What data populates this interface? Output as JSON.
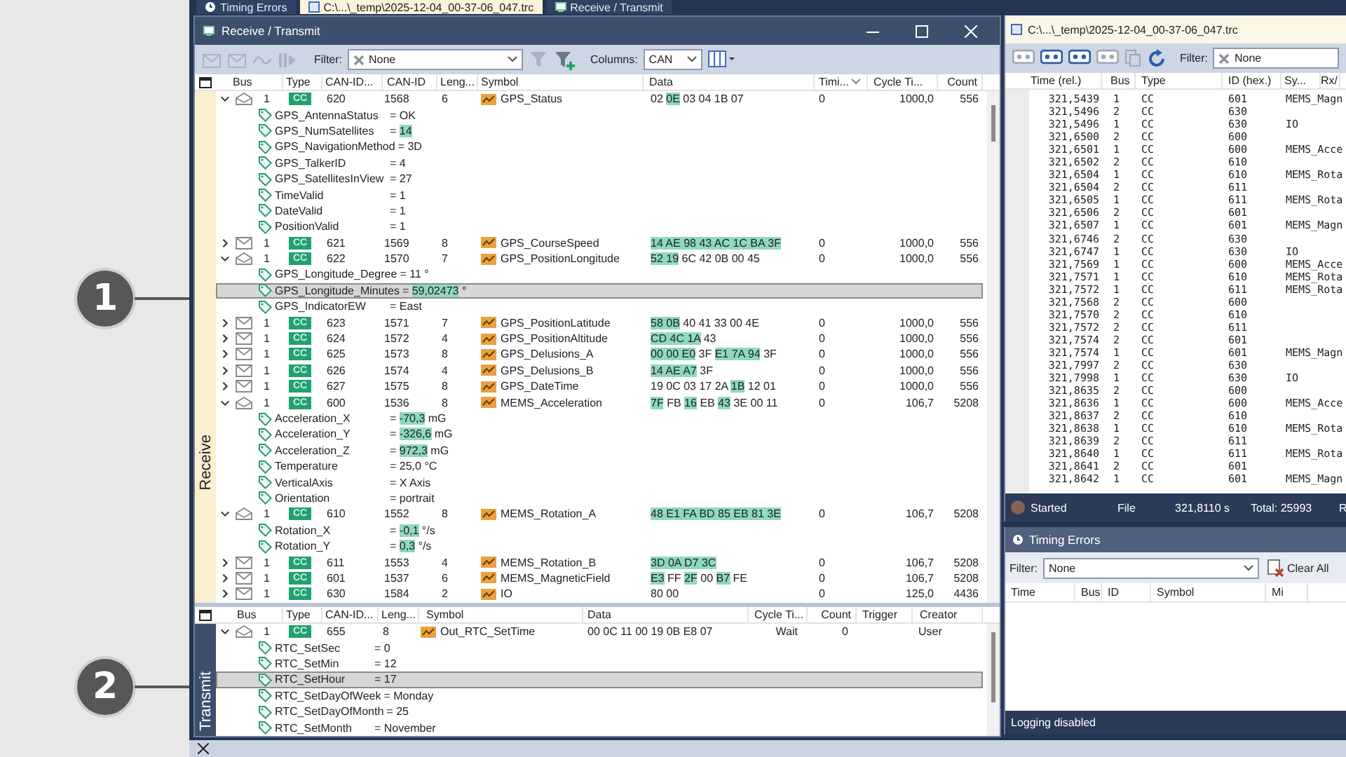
{
  "doc_tabs": [
    {
      "label": "Timing Errors",
      "kind": "clock",
      "selected": false
    },
    {
      "label": "C:\\...\\_temp\\2025-12-04_00-37-06_047.trc",
      "kind": "file",
      "selected": true
    },
    {
      "label": "Receive / Transmit",
      "kind": "window",
      "selected": false
    }
  ],
  "callouts": [
    {
      "number": "1"
    },
    {
      "number": "2"
    }
  ],
  "rx_window": {
    "title": "Receive / Transmit",
    "filter_label": "Filter:",
    "filter_value": "None",
    "columns_label": "Columns:",
    "columns_value": "CAN"
  },
  "receive": {
    "label": "Receive",
    "columns": [
      {
        "label": "Bus",
        "sorted": false
      },
      {
        "label": "Type",
        "sorted": false
      },
      {
        "label": "CAN-ID...",
        "sorted": false
      },
      {
        "label": "CAN-ID",
        "sorted": false
      },
      {
        "label": "Leng...",
        "sorted": false
      },
      {
        "label": "Symbol",
        "sorted": false
      },
      {
        "label": "Data",
        "sorted": false
      },
      {
        "label": "Timi...",
        "sorted": true
      },
      {
        "label": "Cycle Ti...",
        "sorted": false
      },
      {
        "label": "Count",
        "sorted": false
      }
    ],
    "rows": [
      {
        "kind": "message",
        "expanded": true,
        "selected": false,
        "bus": "1",
        "type": "CC",
        "id_hex": "620",
        "id": "1568",
        "length": "6",
        "symbol": "GPS_Status",
        "data": [
          {
            "text": "02",
            "hl": false
          },
          {
            "text": "0E",
            "hl": true
          },
          {
            "text": "03 04 1B 07",
            "hl": false
          }
        ],
        "timing": "0",
        "cycle": "1000,0",
        "count": "556"
      },
      {
        "kind": "signal",
        "selected": false,
        "name": "GPS_AntennaStatus",
        "op": "=",
        "value": "OK",
        "hl": false
      },
      {
        "kind": "signal",
        "selected": false,
        "name": "GPS_NumSatellites",
        "op": "=",
        "value": "14",
        "hl": true
      },
      {
        "kind": "signal",
        "selected": false,
        "name": "GPS_NavigationMethod",
        "op": "=",
        "value": "3D",
        "hl": false
      },
      {
        "kind": "signal",
        "selected": false,
        "name": "GPS_TalkerID",
        "op": "=",
        "value": "4",
        "hl": false
      },
      {
        "kind": "signal",
        "selected": false,
        "name": "GPS_SatellitesInView",
        "op": "=",
        "value": "27",
        "hl": false
      },
      {
        "kind": "signal",
        "selected": false,
        "name": "TimeValid",
        "op": "=",
        "value": "1",
        "hl": false
      },
      {
        "kind": "signal",
        "selected": false,
        "name": "DateValid",
        "op": "=",
        "value": "1",
        "hl": false
      },
      {
        "kind": "signal",
        "selected": false,
        "name": "PositionValid",
        "op": "=",
        "value": "1",
        "hl": false
      },
      {
        "kind": "message",
        "expanded": false,
        "selected": false,
        "bus": "1",
        "type": "CC",
        "id_hex": "621",
        "id": "1569",
        "length": "8",
        "symbol": "GPS_CourseSpeed",
        "data": [
          {
            "text": "14 AE 98 43 AC 1C BA 3F",
            "hl": true
          }
        ],
        "timing": "0",
        "cycle": "1000,0",
        "count": "556"
      },
      {
        "kind": "message",
        "expanded": true,
        "selected": false,
        "bus": "1",
        "type": "CC",
        "id_hex": "622",
        "id": "1570",
        "length": "7",
        "symbol": "GPS_PositionLongitude",
        "data": [
          {
            "text": "52 19",
            "hl": true
          },
          {
            "text": "6C 42 0B 00 45",
            "hl": false
          }
        ],
        "timing": "0",
        "cycle": "1000,0",
        "count": "556"
      },
      {
        "kind": "signal",
        "selected": false,
        "name": "GPS_Longitude_Degree",
        "op": "=",
        "value": "11",
        "unit": "°",
        "hl": false
      },
      {
        "kind": "signal",
        "selected": true,
        "name": "GPS_Longitude_Minutes",
        "op": "=",
        "value": "59,02473",
        "unit": "°",
        "hl": true
      },
      {
        "kind": "signal",
        "selected": false,
        "name": "GPS_IndicatorEW",
        "op": "=",
        "value": "East",
        "hl": false
      },
      {
        "kind": "message",
        "expanded": false,
        "selected": false,
        "bus": "1",
        "type": "CC",
        "id_hex": "623",
        "id": "1571",
        "length": "7",
        "symbol": "GPS_PositionLatitude",
        "data": [
          {
            "text": "58 0B",
            "hl": true
          },
          {
            "text": "40 41 33 00 4E",
            "hl": false
          }
        ],
        "timing": "0",
        "cycle": "1000,0",
        "count": "556"
      },
      {
        "kind": "message",
        "expanded": false,
        "selected": false,
        "bus": "1",
        "type": "CC",
        "id_hex": "624",
        "id": "1572",
        "length": "4",
        "symbol": "GPS_PositionAltitude",
        "data": [
          {
            "text": "CD 4C 1A",
            "hl": true
          },
          {
            "text": "43",
            "hl": false
          }
        ],
        "timing": "0",
        "cycle": "1000,0",
        "count": "556"
      },
      {
        "kind": "message",
        "expanded": false,
        "selected": false,
        "bus": "1",
        "type": "CC",
        "id_hex": "625",
        "id": "1573",
        "length": "8",
        "symbol": "GPS_Delusions_A",
        "data": [
          {
            "text": "00 00 E0",
            "hl": true
          },
          {
            "text": "3F",
            "hl": false
          },
          {
            "text": "E1 7A 94",
            "hl": true
          },
          {
            "text": "3F",
            "hl": false
          }
        ],
        "timing": "0",
        "cycle": "1000,0",
        "count": "556"
      },
      {
        "kind": "message",
        "expanded": false,
        "selected": false,
        "bus": "1",
        "type": "CC",
        "id_hex": "626",
        "id": "1574",
        "length": "4",
        "symbol": "GPS_Delusions_B",
        "data": [
          {
            "text": "14 AE A7",
            "hl": true
          },
          {
            "text": "3F",
            "hl": false
          }
        ],
        "timing": "0",
        "cycle": "1000,0",
        "count": "556"
      },
      {
        "kind": "message",
        "expanded": false,
        "selected": false,
        "bus": "1",
        "type": "CC",
        "id_hex": "627",
        "id": "1575",
        "length": "8",
        "symbol": "GPS_DateTime",
        "data": [
          {
            "text": "19 0C 03 17 2A",
            "hl": false
          },
          {
            "text": "1B",
            "hl": true
          },
          {
            "text": "12 01",
            "hl": false
          }
        ],
        "timing": "0",
        "cycle": "1000,0",
        "count": "556"
      },
      {
        "kind": "message",
        "expanded": true,
        "selected": false,
        "bus": "1",
        "type": "CC",
        "id_hex": "600",
        "id": "1536",
        "length": "8",
        "symbol": "MEMS_Acceleration",
        "data": [
          {
            "text": "7F",
            "hl": true
          },
          {
            "text": "FB",
            "hl": false
          },
          {
            "text": "16",
            "hl": true
          },
          {
            "text": "EB",
            "hl": false
          },
          {
            "text": "43",
            "hl": true
          },
          {
            "text": "3E 00 11",
            "hl": false
          }
        ],
        "timing": "0",
        "cycle": "106,7",
        "count": "5208"
      },
      {
        "kind": "signal",
        "selected": false,
        "name": "Acceleration_X",
        "op": "=",
        "value": "-70,3",
        "unit": "mG",
        "hl": true
      },
      {
        "kind": "signal",
        "selected": false,
        "name": "Acceleration_Y",
        "op": "=",
        "value": "-326,6",
        "unit": "mG",
        "hl": true
      },
      {
        "kind": "signal",
        "selected": false,
        "name": "Acceleration_Z",
        "op": "=",
        "value": "972,3",
        "unit": "mG",
        "hl": true
      },
      {
        "kind": "signal",
        "selected": false,
        "name": "Temperature",
        "op": "=",
        "value": "25,0",
        "unit": "°C",
        "hl": false
      },
      {
        "kind": "signal",
        "selected": false,
        "name": "VerticalAxis",
        "op": "=",
        "value": "X Axis",
        "hl": false
      },
      {
        "kind": "signal",
        "selected": false,
        "name": "Orientation",
        "op": "=",
        "value": "portrait",
        "hl": false
      },
      {
        "kind": "message",
        "expanded": true,
        "selected": false,
        "bus": "1",
        "type": "CC",
        "id_hex": "610",
        "id": "1552",
        "length": "8",
        "symbol": "MEMS_Rotation_A",
        "data": [
          {
            "text": "48 E1 FA BD 85 EB 81 3E",
            "hl": true
          }
        ],
        "timing": "0",
        "cycle": "106,7",
        "count": "5208"
      },
      {
        "kind": "signal",
        "selected": false,
        "name": "Rotation_X",
        "op": "=",
        "value": "-0,1",
        "unit": "°/s",
        "hl": true
      },
      {
        "kind": "signal",
        "selected": false,
        "name": "Rotation_Y",
        "op": "=",
        "value": "0,3",
        "unit": "°/s",
        "hl": true
      },
      {
        "kind": "message",
        "expanded": false,
        "selected": false,
        "bus": "1",
        "type": "CC",
        "id_hex": "611",
        "id": "1553",
        "length": "4",
        "symbol": "MEMS_Rotation_B",
        "data": [
          {
            "text": "3D 0A D7 3C",
            "hl": true
          }
        ],
        "timing": "0",
        "cycle": "106,7",
        "count": "5208"
      },
      {
        "kind": "message",
        "expanded": false,
        "selected": false,
        "bus": "1",
        "type": "CC",
        "id_hex": "601",
        "id": "1537",
        "length": "6",
        "symbol": "MEMS_MagneticField",
        "data": [
          {
            "text": "E3",
            "hl": true
          },
          {
            "text": "FF",
            "hl": false
          },
          {
            "text": "2F",
            "hl": true
          },
          {
            "text": "00",
            "hl": false
          },
          {
            "text": "B7",
            "hl": true
          },
          {
            "text": "FE",
            "hl": false
          }
        ],
        "timing": "0",
        "cycle": "106,7",
        "count": "5208"
      },
      {
        "kind": "message",
        "expanded": false,
        "selected": false,
        "bus": "1",
        "type": "CC",
        "id_hex": "630",
        "id": "1584",
        "length": "2",
        "symbol": "IO",
        "data": [
          {
            "text": "80 00",
            "hl": false
          }
        ],
        "timing": "0",
        "cycle": "125,0",
        "count": "4436"
      }
    ]
  },
  "transmit": {
    "label": "Transmit",
    "columns": [
      {
        "label": "Bus",
        "sorted": false
      },
      {
        "label": "Type",
        "sorted": false
      },
      {
        "label": "CAN-ID...",
        "sorted": false
      },
      {
        "label": "Leng...",
        "sorted": false
      },
      {
        "label": "Symbol",
        "sorted": false
      },
      {
        "label": "Data",
        "sorted": false
      },
      {
        "label": "Cycle Ti...",
        "sorted": false
      },
      {
        "label": "Count",
        "sorted": false
      },
      {
        "label": "Trigger",
        "sorted": false
      },
      {
        "label": "Creator",
        "sorted": false
      }
    ],
    "rows": [
      {
        "kind": "message",
        "expanded": true,
        "selected": false,
        "bus": "1",
        "type": "CC",
        "id_hex": "655",
        "length": "8",
        "symbol": "Out_RTC_SetTime",
        "data": [
          {
            "text": "00 0C 11 00 19 0B E8 07",
            "hl": false
          }
        ],
        "cycle": "Wait",
        "count": "0",
        "creator": "User"
      },
      {
        "kind": "signal",
        "selected": false,
        "name": "RTC_SetSec",
        "op": "=",
        "value": "0",
        "hl": false
      },
      {
        "kind": "signal",
        "selected": false,
        "name": "RTC_SetMin",
        "op": "=",
        "value": "12",
        "hl": false
      },
      {
        "kind": "signal",
        "selected": true,
        "name": "RTC_SetHour",
        "op": "=",
        "value": "17",
        "hl": false
      },
      {
        "kind": "signal",
        "selected": false,
        "name": "RTC_SetDayOfWeek",
        "op": "=",
        "value": "Monday",
        "hl": false
      },
      {
        "kind": "signal",
        "selected": false,
        "name": "RTC_SetDayOfMonth",
        "op": "=",
        "value": "25",
        "hl": false
      },
      {
        "kind": "signal",
        "selected": false,
        "name": "RTC_SetMonth",
        "op": "=",
        "value": "November",
        "hl": false
      }
    ]
  },
  "trace_window": {
    "title": "C:\\...\\_temp\\2025-12-04_00-37-06_047.trc",
    "filter_label": "Filter:",
    "filter_value": "None",
    "columns": [
      "Time (rel.)",
      "Bus",
      "Type",
      "ID (hex.)",
      "Sy...",
      "Rx/"
    ],
    "rows": [
      [
        "321,5439",
        "1",
        "CC",
        "601",
        "MEMS_Magn"
      ],
      [
        "321,5496",
        "2",
        "CC",
        "630"
      ],
      [
        "321,5496",
        "1",
        "CC",
        "630",
        "IO"
      ],
      [
        "321,6500",
        "2",
        "CC",
        "600"
      ],
      [
        "321,6501",
        "1",
        "CC",
        "600",
        "MEMS_Acce"
      ],
      [
        "321,6502",
        "2",
        "CC",
        "610"
      ],
      [
        "321,6504",
        "1",
        "CC",
        "610",
        "MEMS_Rota"
      ],
      [
        "321,6504",
        "2",
        "CC",
        "611"
      ],
      [
        "321,6505",
        "1",
        "CC",
        "611",
        "MEMS_Rota"
      ],
      [
        "321,6506",
        "2",
        "CC",
        "601"
      ],
      [
        "321,6507",
        "1",
        "CC",
        "601",
        "MEMS_Magn"
      ],
      [
        "321,6746",
        "2",
        "CC",
        "630"
      ],
      [
        "321,6747",
        "1",
        "CC",
        "630",
        "IO"
      ],
      [
        "321,7569",
        "1",
        "CC",
        "600",
        "MEMS_Acce"
      ],
      [
        "321,7571",
        "1",
        "CC",
        "610",
        "MEMS_Rota"
      ],
      [
        "321,7572",
        "1",
        "CC",
        "611",
        "MEMS_Rota"
      ],
      [
        "321,7568",
        "2",
        "CC",
        "600"
      ],
      [
        "321,7570",
        "2",
        "CC",
        "610"
      ],
      [
        "321,7572",
        "2",
        "CC",
        "611"
      ],
      [
        "321,7574",
        "2",
        "CC",
        "601"
      ],
      [
        "321,7574",
        "1",
        "CC",
        "601",
        "MEMS_Magn"
      ],
      [
        "321,7997",
        "2",
        "CC",
        "630"
      ],
      [
        "321,7998",
        "1",
        "CC",
        "630",
        "IO"
      ],
      [
        "321,8635",
        "2",
        "CC",
        "600"
      ],
      [
        "321,8636",
        "1",
        "CC",
        "600",
        "MEMS_Acce"
      ],
      [
        "321,8637",
        "2",
        "CC",
        "610"
      ],
      [
        "321,8638",
        "1",
        "CC",
        "610",
        "MEMS_Rota"
      ],
      [
        "321,8639",
        "2",
        "CC",
        "611"
      ],
      [
        "321,8640",
        "1",
        "CC",
        "611",
        "MEMS_Rota"
      ],
      [
        "321,8641",
        "2",
        "CC",
        "601"
      ],
      [
        "321,8642",
        "1",
        "CC",
        "601",
        "MEMS_Magn"
      ]
    ],
    "status": {
      "state": "Started",
      "source": "File",
      "time": "321,8110 s",
      "total": "Total: 25993",
      "rx": "R"
    }
  },
  "timing_errors": {
    "title": "Timing Errors",
    "filter_label": "Filter:",
    "filter_value": "None",
    "clear_button": "Clear All",
    "columns": [
      "Time",
      "Bus",
      "ID",
      "Symbol",
      "Mi"
    ],
    "footer": "Logging disabled"
  }
}
